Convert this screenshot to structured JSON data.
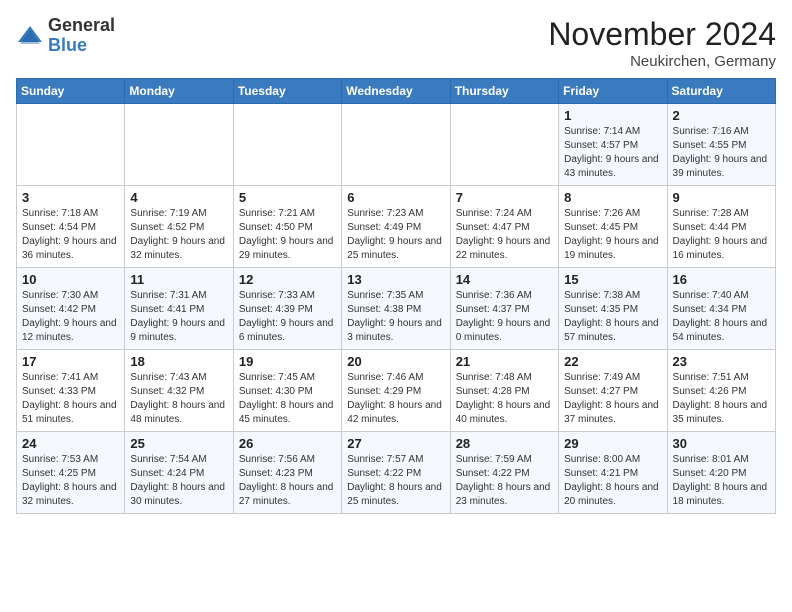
{
  "header": {
    "logo_general": "General",
    "logo_blue": "Blue",
    "title": "November 2024",
    "location": "Neukirchen, Germany"
  },
  "calendar": {
    "days_of_week": [
      "Sunday",
      "Monday",
      "Tuesday",
      "Wednesday",
      "Thursday",
      "Friday",
      "Saturday"
    ],
    "weeks": [
      [
        {
          "day": "",
          "info": ""
        },
        {
          "day": "",
          "info": ""
        },
        {
          "day": "",
          "info": ""
        },
        {
          "day": "",
          "info": ""
        },
        {
          "day": "",
          "info": ""
        },
        {
          "day": "1",
          "info": "Sunrise: 7:14 AM\nSunset: 4:57 PM\nDaylight: 9 hours and 43 minutes."
        },
        {
          "day": "2",
          "info": "Sunrise: 7:16 AM\nSunset: 4:55 PM\nDaylight: 9 hours and 39 minutes."
        }
      ],
      [
        {
          "day": "3",
          "info": "Sunrise: 7:18 AM\nSunset: 4:54 PM\nDaylight: 9 hours and 36 minutes."
        },
        {
          "day": "4",
          "info": "Sunrise: 7:19 AM\nSunset: 4:52 PM\nDaylight: 9 hours and 32 minutes."
        },
        {
          "day": "5",
          "info": "Sunrise: 7:21 AM\nSunset: 4:50 PM\nDaylight: 9 hours and 29 minutes."
        },
        {
          "day": "6",
          "info": "Sunrise: 7:23 AM\nSunset: 4:49 PM\nDaylight: 9 hours and 25 minutes."
        },
        {
          "day": "7",
          "info": "Sunrise: 7:24 AM\nSunset: 4:47 PM\nDaylight: 9 hours and 22 minutes."
        },
        {
          "day": "8",
          "info": "Sunrise: 7:26 AM\nSunset: 4:45 PM\nDaylight: 9 hours and 19 minutes."
        },
        {
          "day": "9",
          "info": "Sunrise: 7:28 AM\nSunset: 4:44 PM\nDaylight: 9 hours and 16 minutes."
        }
      ],
      [
        {
          "day": "10",
          "info": "Sunrise: 7:30 AM\nSunset: 4:42 PM\nDaylight: 9 hours and 12 minutes."
        },
        {
          "day": "11",
          "info": "Sunrise: 7:31 AM\nSunset: 4:41 PM\nDaylight: 9 hours and 9 minutes."
        },
        {
          "day": "12",
          "info": "Sunrise: 7:33 AM\nSunset: 4:39 PM\nDaylight: 9 hours and 6 minutes."
        },
        {
          "day": "13",
          "info": "Sunrise: 7:35 AM\nSunset: 4:38 PM\nDaylight: 9 hours and 3 minutes."
        },
        {
          "day": "14",
          "info": "Sunrise: 7:36 AM\nSunset: 4:37 PM\nDaylight: 9 hours and 0 minutes."
        },
        {
          "day": "15",
          "info": "Sunrise: 7:38 AM\nSunset: 4:35 PM\nDaylight: 8 hours and 57 minutes."
        },
        {
          "day": "16",
          "info": "Sunrise: 7:40 AM\nSunset: 4:34 PM\nDaylight: 8 hours and 54 minutes."
        }
      ],
      [
        {
          "day": "17",
          "info": "Sunrise: 7:41 AM\nSunset: 4:33 PM\nDaylight: 8 hours and 51 minutes."
        },
        {
          "day": "18",
          "info": "Sunrise: 7:43 AM\nSunset: 4:32 PM\nDaylight: 8 hours and 48 minutes."
        },
        {
          "day": "19",
          "info": "Sunrise: 7:45 AM\nSunset: 4:30 PM\nDaylight: 8 hours and 45 minutes."
        },
        {
          "day": "20",
          "info": "Sunrise: 7:46 AM\nSunset: 4:29 PM\nDaylight: 8 hours and 42 minutes."
        },
        {
          "day": "21",
          "info": "Sunrise: 7:48 AM\nSunset: 4:28 PM\nDaylight: 8 hours and 40 minutes."
        },
        {
          "day": "22",
          "info": "Sunrise: 7:49 AM\nSunset: 4:27 PM\nDaylight: 8 hours and 37 minutes."
        },
        {
          "day": "23",
          "info": "Sunrise: 7:51 AM\nSunset: 4:26 PM\nDaylight: 8 hours and 35 minutes."
        }
      ],
      [
        {
          "day": "24",
          "info": "Sunrise: 7:53 AM\nSunset: 4:25 PM\nDaylight: 8 hours and 32 minutes."
        },
        {
          "day": "25",
          "info": "Sunrise: 7:54 AM\nSunset: 4:24 PM\nDaylight: 8 hours and 30 minutes."
        },
        {
          "day": "26",
          "info": "Sunrise: 7:56 AM\nSunset: 4:23 PM\nDaylight: 8 hours and 27 minutes."
        },
        {
          "day": "27",
          "info": "Sunrise: 7:57 AM\nSunset: 4:22 PM\nDaylight: 8 hours and 25 minutes."
        },
        {
          "day": "28",
          "info": "Sunrise: 7:59 AM\nSunset: 4:22 PM\nDaylight: 8 hours and 23 minutes."
        },
        {
          "day": "29",
          "info": "Sunrise: 8:00 AM\nSunset: 4:21 PM\nDaylight: 8 hours and 20 minutes."
        },
        {
          "day": "30",
          "info": "Sunrise: 8:01 AM\nSunset: 4:20 PM\nDaylight: 8 hours and 18 minutes."
        }
      ]
    ]
  }
}
